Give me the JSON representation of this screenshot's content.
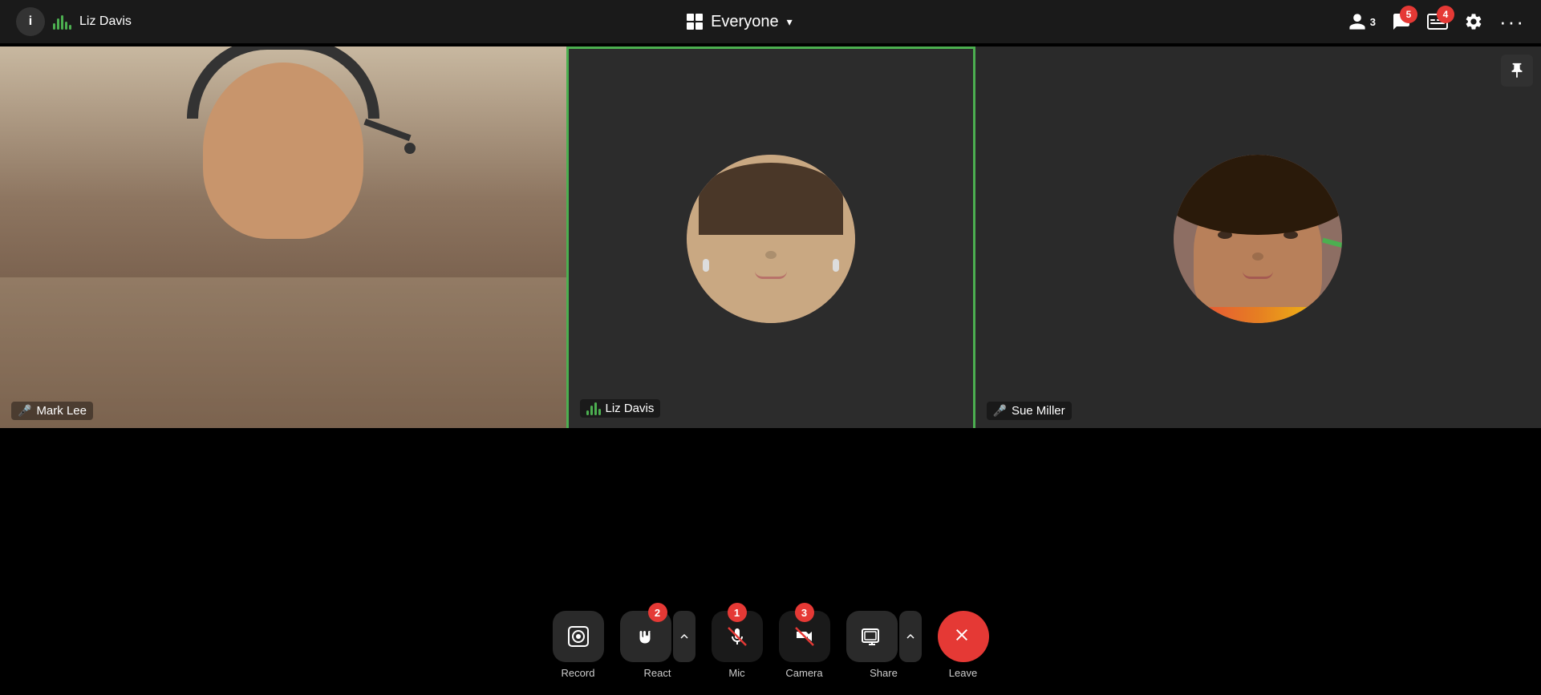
{
  "header": {
    "info_label": "i",
    "user_name": "Liz Davis",
    "group_icon": "grid",
    "everyone_label": "Everyone",
    "chevron": "▾",
    "participants_count": "3",
    "chat_icon": "chat",
    "captions_icon": "captions",
    "settings_icon": "settings",
    "more_icon": "...",
    "notification_5": "5",
    "notification_4": "4"
  },
  "participants": [
    {
      "name": "Mark Lee",
      "muted": true,
      "is_active": false,
      "has_video": true
    },
    {
      "name": "Liz Davis",
      "muted": false,
      "is_active": true,
      "has_video": false
    },
    {
      "name": "Sue Miller",
      "muted": true,
      "is_active": false,
      "has_video": false
    }
  ],
  "toolbar": {
    "record_label": "Record",
    "react_label": "React",
    "mic_label": "Mic",
    "camera_label": "Camera",
    "share_label": "Share",
    "leave_label": "Leave",
    "badge_react": "2",
    "badge_mic": "1",
    "badge_camera": "3"
  }
}
